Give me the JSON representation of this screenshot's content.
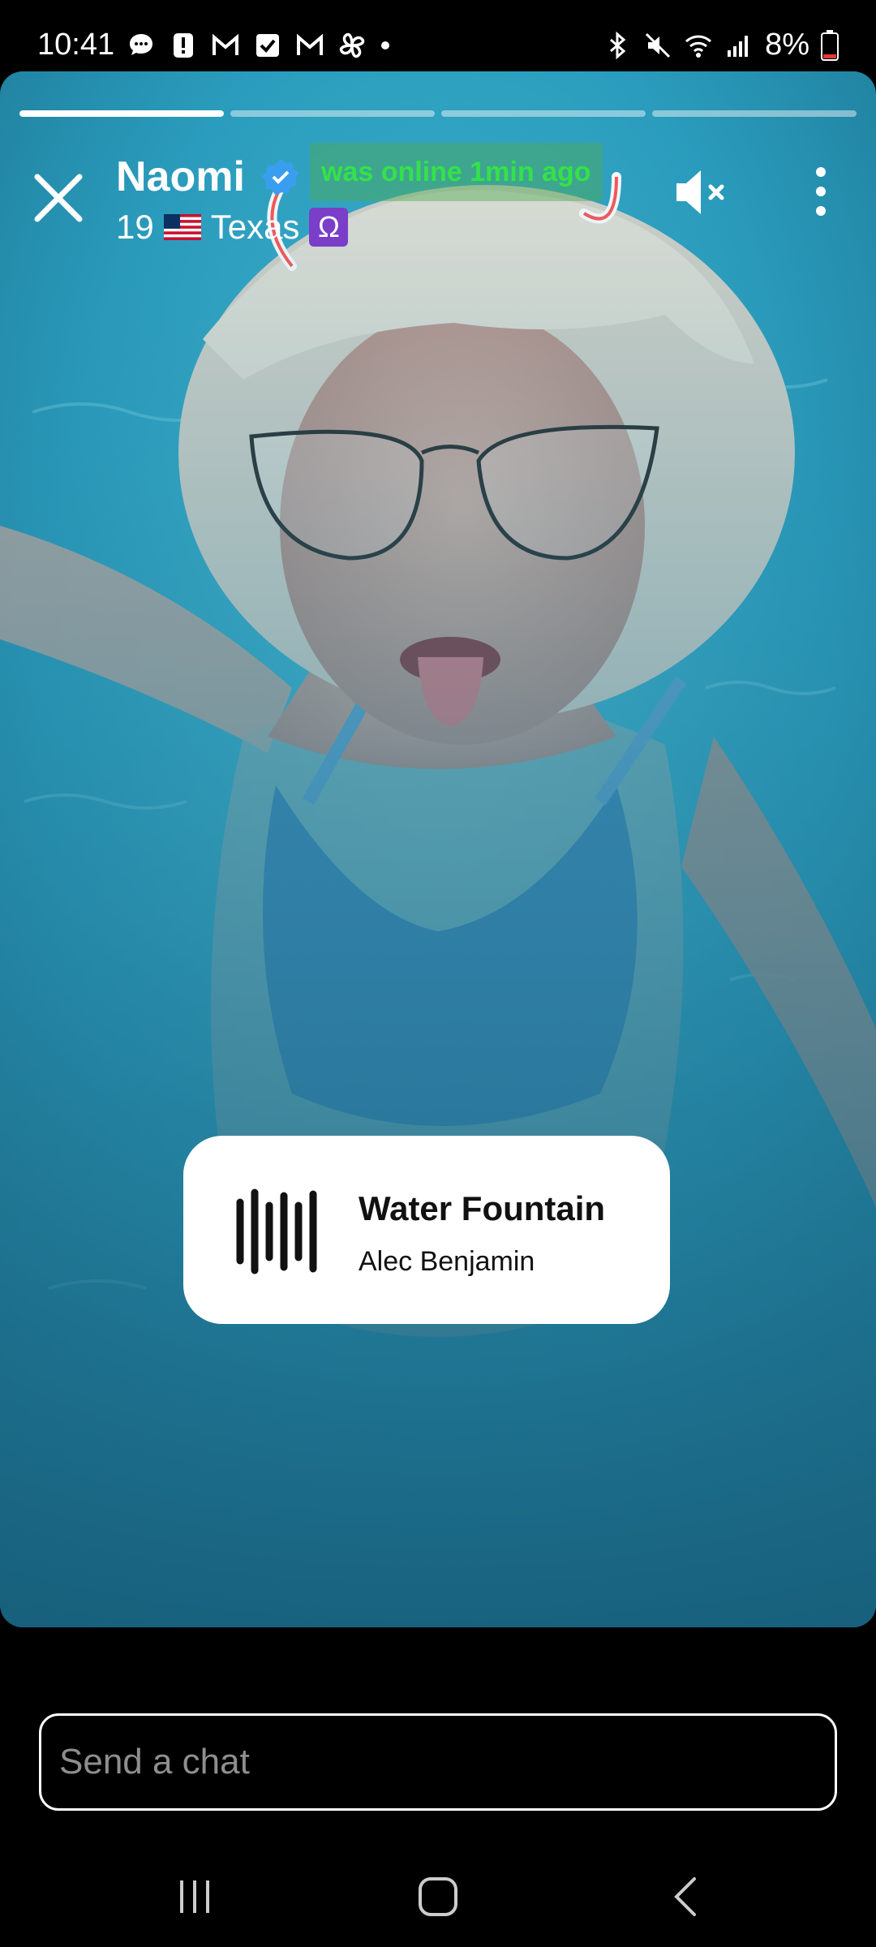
{
  "status_bar": {
    "time": "10:41",
    "battery": "8%",
    "left_icons": [
      "messages-icon",
      "alert-icon",
      "gmail-icon",
      "check-icon",
      "gmail-icon",
      "pinwheel-icon",
      "dot-icon"
    ],
    "right_icons": [
      "bluetooth-icon",
      "mute-icon",
      "wifi-icon",
      "signal-icon",
      "battery-icon"
    ]
  },
  "story": {
    "segments": [
      1,
      0,
      0,
      0
    ],
    "user": {
      "name": "Naomi",
      "verified": true,
      "online_status": "was online 1min ago",
      "age": "19",
      "flag": "us-flag",
      "location": "Texas",
      "zodiac": "Ω"
    },
    "colors": {
      "online_text": "#33e24a",
      "verified_badge": "#3a9ef0",
      "water": "#2ea6c4",
      "zodiac_bg": "#7b3ec9"
    },
    "music": {
      "title": "Water Fountain",
      "artist": "Alec Benjamin"
    }
  },
  "chat": {
    "placeholder": "Send a chat"
  },
  "nav": {
    "icons": [
      "recents-icon",
      "home-icon",
      "back-icon"
    ]
  }
}
